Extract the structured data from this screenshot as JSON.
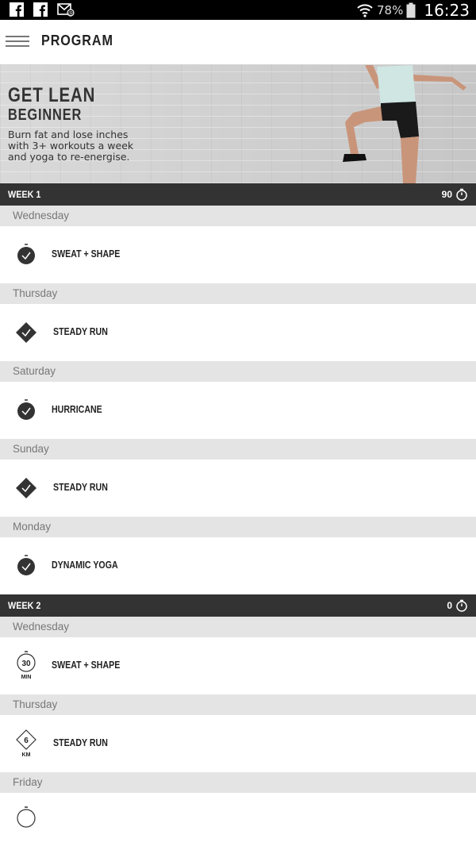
{
  "status_bar": {
    "icons": [
      "facebook-icon",
      "facebook-icon",
      "email-notification-icon"
    ],
    "wifi": "wifi-icon",
    "battery_percent": "78%",
    "time": "16:23"
  },
  "app_bar": {
    "title": "PROGRAM",
    "menu_icon": "hamburger-menu-icon"
  },
  "hero": {
    "title": "GET LEAN",
    "subtitle": "BEGINNER",
    "description": "Burn fat and lose inches with 3+ workouts a week and yoga to re-energise."
  },
  "weeks": [
    {
      "label": "WEEK 1",
      "count": "90",
      "days": [
        {
          "day": "Wednesday",
          "workout": "SWEAT + SHAPE",
          "icon": "completed-timer-icon"
        },
        {
          "day": "Thursday",
          "workout": "STEADY RUN",
          "icon": "completed-run-diamond-icon"
        },
        {
          "day": "Saturday",
          "workout": "HURRICANE",
          "icon": "completed-timer-icon"
        },
        {
          "day": "Sunday",
          "workout": "STEADY RUN",
          "icon": "completed-run-diamond-icon"
        },
        {
          "day": "Monday",
          "workout": "DYNAMIC YOGA",
          "icon": "completed-timer-icon"
        }
      ]
    },
    {
      "label": "WEEK 2",
      "count": "0",
      "days": [
        {
          "day": "Wednesday",
          "workout": "SWEAT + SHAPE",
          "icon": "timer-icon",
          "metric": "30",
          "unit": "MIN"
        },
        {
          "day": "Thursday",
          "workout": "STEADY RUN",
          "icon": "run-distance-diamond-icon",
          "metric": "6",
          "unit": "KM"
        },
        {
          "day": "Friday",
          "workout": "",
          "icon": "timer-icon"
        }
      ]
    }
  ]
}
